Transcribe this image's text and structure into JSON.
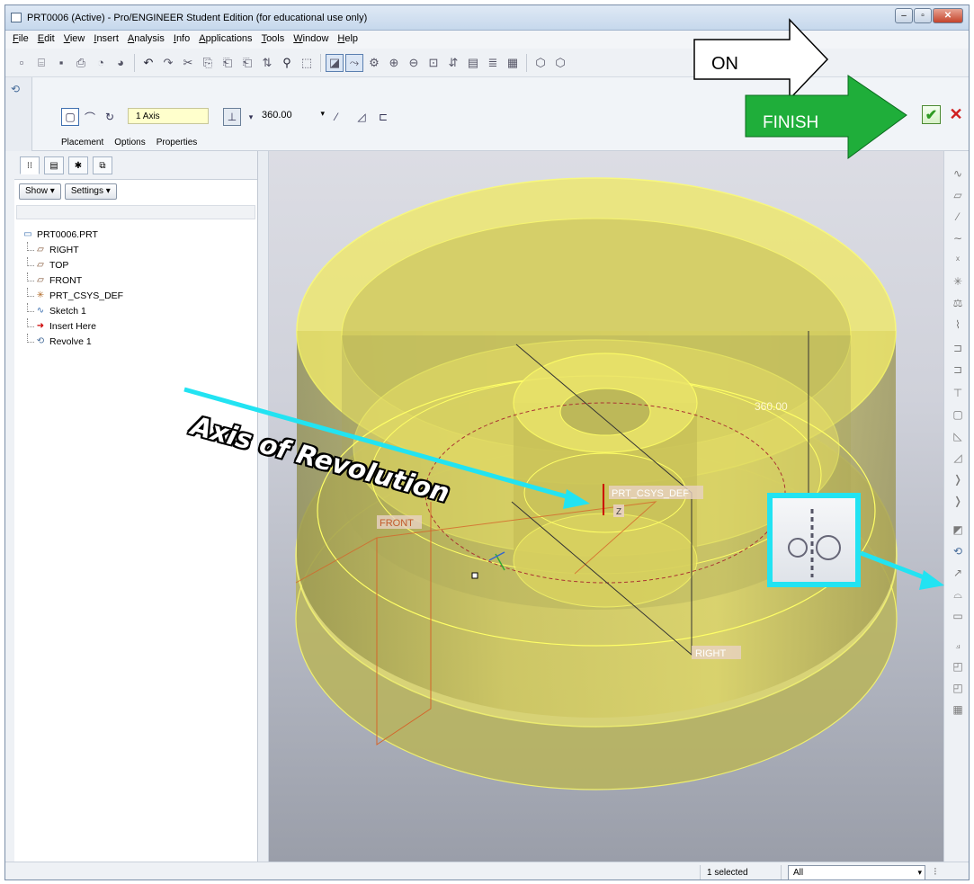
{
  "window": {
    "title": "PRT0006 (Active) - Pro/ENGINEER Student Edition (for educational use only)"
  },
  "menu": [
    "File",
    "Edit",
    "View",
    "Insert",
    "Analysis",
    "Info",
    "Applications",
    "Tools",
    "Window",
    "Help"
  ],
  "menu_mnemonics": [
    "F",
    "E",
    "V",
    "I",
    "A",
    "I",
    "A",
    "T",
    "W",
    "H"
  ],
  "dashboard": {
    "axis_collector": "1 Axis",
    "angle_value": "360.00",
    "tabs": [
      "Placement",
      "Options",
      "Properties"
    ]
  },
  "model_tree": {
    "tab_icons": [
      "model-tree-icon",
      "folder-icon",
      "favorites-icon",
      "layers-icon"
    ],
    "show_button": "Show ▾",
    "settings_button": "Settings ▾",
    "items": [
      {
        "label": "PRT0006.PRT",
        "icon": "part-icon",
        "level": 0
      },
      {
        "label": "RIGHT",
        "icon": "datum-plane-icon",
        "level": 1
      },
      {
        "label": "TOP",
        "icon": "datum-plane-icon",
        "level": 1
      },
      {
        "label": "FRONT",
        "icon": "datum-plane-icon",
        "level": 1
      },
      {
        "label": "PRT_CSYS_DEF",
        "icon": "csys-icon",
        "level": 1
      },
      {
        "label": "Sketch 1",
        "icon": "sketch-icon",
        "level": 1
      },
      {
        "label": "Insert Here",
        "icon": "insert-arrow-icon",
        "level": 1
      },
      {
        "label": "Revolve 1",
        "icon": "revolve-icon",
        "level": 1
      }
    ]
  },
  "graphics": {
    "dimension_label": "360.00",
    "plane_labels": [
      "FRONT",
      "RIGHT"
    ],
    "csys_label": "PRT_CSYS_DEF",
    "axis_letter": "Z"
  },
  "annotations": {
    "on_label": "ON",
    "finish_label": "FINISH",
    "axis_label": "Axis of Revolution",
    "colors": {
      "on_arrow": "#ffffff",
      "finish_arrow": "#1fae3a",
      "pointer": "#22e3f2"
    }
  },
  "status": {
    "selected_text": "1 selected",
    "filter_value": "All"
  },
  "colors": {
    "part_fill": "#e8e05a",
    "part_edge": "#ffff66",
    "datum": "#d4652a"
  }
}
